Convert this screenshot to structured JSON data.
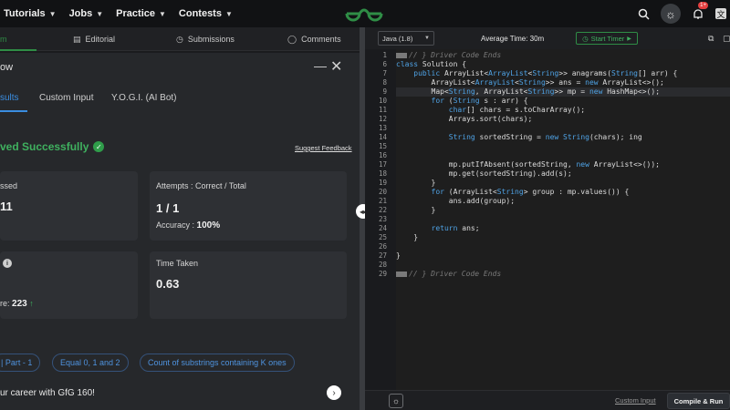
{
  "nav": {
    "items": [
      "Tutorials",
      "Jobs",
      "Practice",
      "Contests"
    ],
    "notification_count": "1+"
  },
  "left_tabs": {
    "active_label": "m",
    "editorial": "Editorial",
    "submissions": "Submissions",
    "comments": "Comments"
  },
  "panel": {
    "title": "ow",
    "minimize": "—",
    "close": "✕",
    "subtabs": [
      "sults",
      "Custom Input",
      "Y.O.G.I. (AI Bot)"
    ],
    "status": "ved Successfully",
    "suggest_feedback": "Suggest Feedback"
  },
  "cards": {
    "passed_label": "ssed",
    "passed_value": "11",
    "attempts_label": "Attempts : Correct / Total",
    "attempts_value": "1 / 1",
    "accuracy_label": "Accuracy :",
    "accuracy_value": "100%",
    "score_label_suffix": "re:",
    "score_value": "223",
    "time_label": "Time Taken",
    "time_value": "0.63"
  },
  "chips": [
    "| Part - 1",
    "Equal 0, 1 and 2",
    "Count of substrings containing K ones"
  ],
  "promo": "ur career with GfG 160!",
  "editor": {
    "language": "Java (1.8)",
    "average_time": "Average Time: 30m",
    "start_timer": "Start Timer",
    "custom_input": "Custom Input",
    "compile_run": "Compile & Run",
    "line_numbers": [
      "1",
      "6",
      "7",
      "8",
      "9",
      "10",
      "11",
      "12",
      "13",
      "14",
      "15",
      "16",
      "17",
      "18",
      "19",
      "20",
      "21",
      "22",
      "23",
      "24",
      "25",
      "26",
      "27",
      "28",
      "29"
    ]
  },
  "colors": {
    "accent_green": "#2f8d46",
    "success_green": "#3fb15f",
    "link_blue": "#3a8de0"
  }
}
